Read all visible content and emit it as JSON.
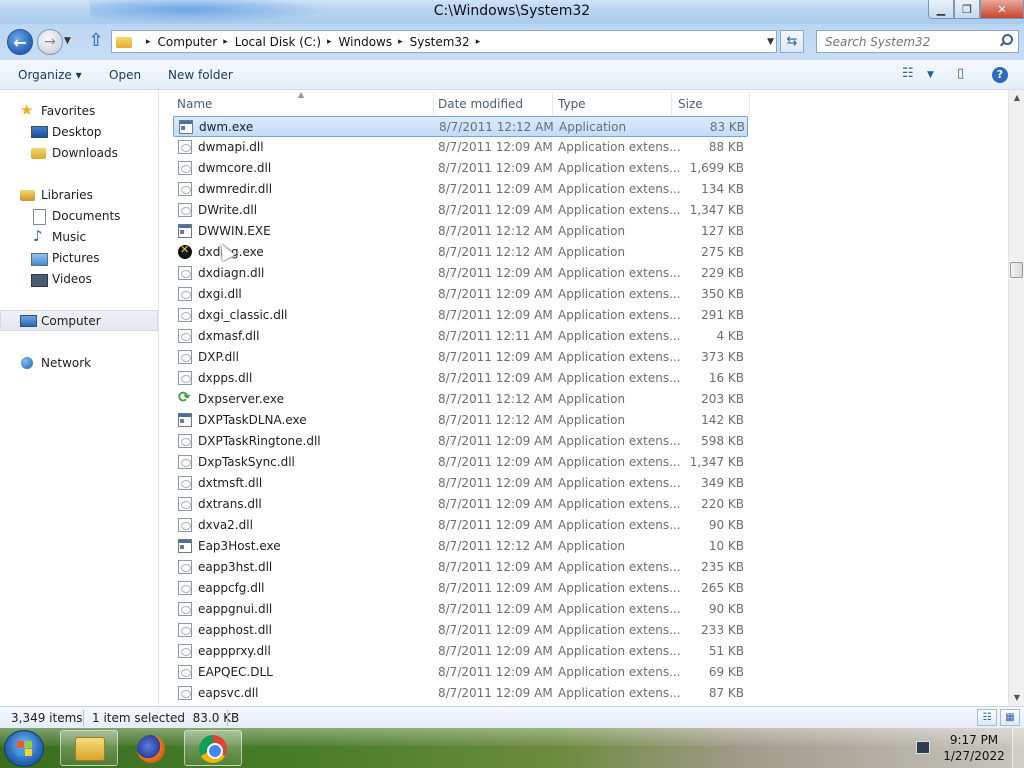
{
  "window": {
    "title": "C:\\Windows\\System32"
  },
  "address": {
    "crumbs": [
      "Computer",
      "Local Disk (C:)",
      "Windows",
      "System32"
    ],
    "search_placeholder": "Search System32"
  },
  "toolbar": {
    "organize": "Organize ▾",
    "open": "Open",
    "new_folder": "New folder"
  },
  "nav": {
    "favorites": "Favorites",
    "desktop": "Desktop",
    "downloads": "Downloads",
    "libraries": "Libraries",
    "documents": "Documents",
    "music": "Music",
    "pictures": "Pictures",
    "videos": "Videos",
    "computer": "Computer",
    "network": "Network"
  },
  "columns": {
    "name": "Name",
    "date": "Date modified",
    "type": "Type",
    "size": "Size"
  },
  "files": [
    {
      "name": "dwm.exe",
      "date": "8/7/2011 12:12 AM",
      "type": "Application",
      "size": "83 KB",
      "icon": "exe",
      "selected": true
    },
    {
      "name": "dwmapi.dll",
      "date": "8/7/2011 12:09 AM",
      "type": "Application extens...",
      "size": "88 KB",
      "icon": "dll"
    },
    {
      "name": "dwmcore.dll",
      "date": "8/7/2011 12:09 AM",
      "type": "Application extens...",
      "size": "1,699 KB",
      "icon": "dll"
    },
    {
      "name": "dwmredir.dll",
      "date": "8/7/2011 12:09 AM",
      "type": "Application extens...",
      "size": "134 KB",
      "icon": "dll"
    },
    {
      "name": "DWrite.dll",
      "date": "8/7/2011 12:09 AM",
      "type": "Application extens...",
      "size": "1,347 KB",
      "icon": "dll"
    },
    {
      "name": "DWWIN.EXE",
      "date": "8/7/2011 12:12 AM",
      "type": "Application",
      "size": "127 KB",
      "icon": "exe"
    },
    {
      "name": "dxdiag.exe",
      "date": "8/7/2011 12:12 AM",
      "type": "Application",
      "size": "275 KB",
      "icon": "dx"
    },
    {
      "name": "dxdiagn.dll",
      "date": "8/7/2011 12:09 AM",
      "type": "Application extens...",
      "size": "229 KB",
      "icon": "dll"
    },
    {
      "name": "dxgi.dll",
      "date": "8/7/2011 12:09 AM",
      "type": "Application extens...",
      "size": "350 KB",
      "icon": "dll"
    },
    {
      "name": "dxgi_classic.dll",
      "date": "8/7/2011 12:09 AM",
      "type": "Application extens...",
      "size": "291 KB",
      "icon": "dll"
    },
    {
      "name": "dxmasf.dll",
      "date": "8/7/2011 12:11 AM",
      "type": "Application extens...",
      "size": "4 KB",
      "icon": "dll"
    },
    {
      "name": "DXP.dll",
      "date": "8/7/2011 12:09 AM",
      "type": "Application extens...",
      "size": "373 KB",
      "icon": "dll"
    },
    {
      "name": "dxpps.dll",
      "date": "8/7/2011 12:09 AM",
      "type": "Application extens...",
      "size": "16 KB",
      "icon": "dll"
    },
    {
      "name": "Dxpserver.exe",
      "date": "8/7/2011 12:12 AM",
      "type": "Application",
      "size": "203 KB",
      "icon": "sync"
    },
    {
      "name": "DXPTaskDLNA.exe",
      "date": "8/7/2011 12:12 AM",
      "type": "Application",
      "size": "142 KB",
      "icon": "exe"
    },
    {
      "name": "DXPTaskRingtone.dll",
      "date": "8/7/2011 12:09 AM",
      "type": "Application extens...",
      "size": "598 KB",
      "icon": "dll"
    },
    {
      "name": "DxpTaskSync.dll",
      "date": "8/7/2011 12:09 AM",
      "type": "Application extens...",
      "size": "1,347 KB",
      "icon": "dll"
    },
    {
      "name": "dxtmsft.dll",
      "date": "8/7/2011 12:09 AM",
      "type": "Application extens...",
      "size": "349 KB",
      "icon": "dll"
    },
    {
      "name": "dxtrans.dll",
      "date": "8/7/2011 12:09 AM",
      "type": "Application extens...",
      "size": "220 KB",
      "icon": "dll"
    },
    {
      "name": "dxva2.dll",
      "date": "8/7/2011 12:09 AM",
      "type": "Application extens...",
      "size": "90 KB",
      "icon": "dll"
    },
    {
      "name": "Eap3Host.exe",
      "date": "8/7/2011 12:12 AM",
      "type": "Application",
      "size": "10 KB",
      "icon": "exe"
    },
    {
      "name": "eapp3hst.dll",
      "date": "8/7/2011 12:09 AM",
      "type": "Application extens...",
      "size": "235 KB",
      "icon": "dll"
    },
    {
      "name": "eappcfg.dll",
      "date": "8/7/2011 12:09 AM",
      "type": "Application extens...",
      "size": "265 KB",
      "icon": "dll"
    },
    {
      "name": "eappgnui.dll",
      "date": "8/7/2011 12:09 AM",
      "type": "Application extens...",
      "size": "90 KB",
      "icon": "dll"
    },
    {
      "name": "eapphost.dll",
      "date": "8/7/2011 12:09 AM",
      "type": "Application extens...",
      "size": "233 KB",
      "icon": "dll"
    },
    {
      "name": "eappprxy.dll",
      "date": "8/7/2011 12:09 AM",
      "type": "Application extens...",
      "size": "51 KB",
      "icon": "dll"
    },
    {
      "name": "EAPQEC.DLL",
      "date": "8/7/2011 12:09 AM",
      "type": "Application extens...",
      "size": "69 KB",
      "icon": "dll"
    },
    {
      "name": "eapsvc.dll",
      "date": "8/7/2011 12:09 AM",
      "type": "Application extens...",
      "size": "87 KB",
      "icon": "dll"
    }
  ],
  "status": {
    "count": "3,349 items",
    "selection": "1 item selected  83.0 KB"
  },
  "taskbar": {
    "time": "9:17 PM",
    "date": "1/27/2022"
  }
}
